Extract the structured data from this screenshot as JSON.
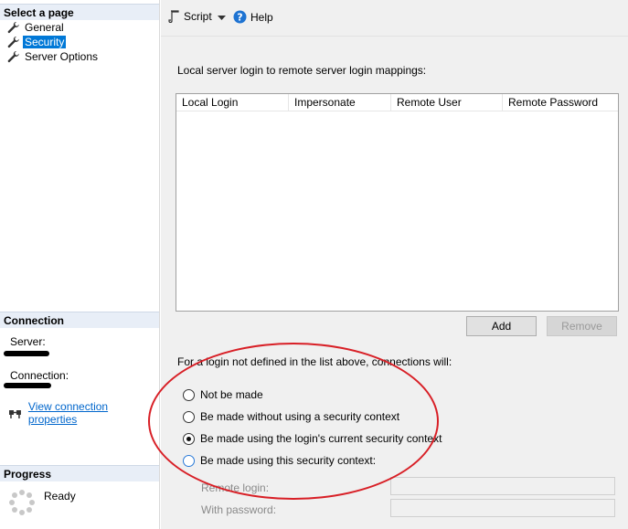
{
  "left_panel": {
    "select_page_header": "Select a page",
    "pages": [
      {
        "label": "General"
      },
      {
        "label": "Security"
      },
      {
        "label": "Server Options"
      }
    ],
    "connection_header": "Connection",
    "server_label": "Server:",
    "connection_label": "Connection:",
    "view_connection_link": "View connection properties",
    "progress_header": "Progress",
    "progress_status": "Ready"
  },
  "toolbar": {
    "script_label": "Script",
    "help_label": "Help"
  },
  "main": {
    "mapping_label": "Local server login to remote server login mappings:",
    "columns": [
      "Local Login",
      "Impersonate",
      "Remote User",
      "Remote Password"
    ],
    "add_button": "Add",
    "remove_button": "Remove",
    "hint": "For a login not defined in the list above, connections will:",
    "options": [
      {
        "label": "Not be made",
        "checked": false
      },
      {
        "label": "Be made without using a security context",
        "checked": false
      },
      {
        "label": "Be made using the login's current security context",
        "checked": true
      },
      {
        "label": "Be made using this security context:",
        "checked": false
      }
    ],
    "remote_login_label": "Remote login:",
    "password_label": "With password:"
  },
  "colors": {
    "selected_bg": "#0078d7",
    "link": "#0066cc",
    "annotation": "#d81f26",
    "section_header_bg": "#e8eef7"
  }
}
